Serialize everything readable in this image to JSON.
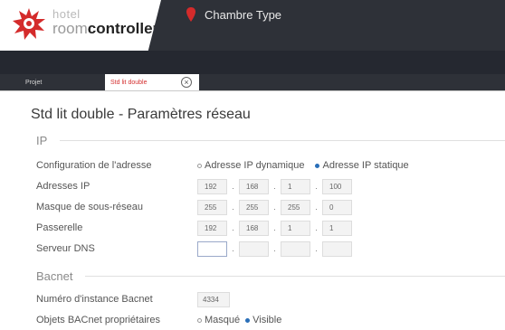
{
  "app": {
    "logo_hotel": "hotel",
    "logo_room": "room",
    "logo_controller": "controller",
    "context_title": "Chambre Type",
    "brand_color": "#d42b2b"
  },
  "tabs": [
    {
      "label": "Projet",
      "active": false
    },
    {
      "label": "Std lit double",
      "active": true
    }
  ],
  "page": {
    "title": "Std lit double - Paramètres réseau"
  },
  "ip_section": {
    "title": "IP",
    "config_label": "Configuration de l'adresse",
    "config_options": [
      {
        "label": "Adresse IP dynamique",
        "selected": false
      },
      {
        "label": "Adresse IP statique",
        "selected": true
      }
    ],
    "fields": [
      {
        "label": "Adresses IP",
        "octets": [
          "192",
          "168",
          "1",
          "100"
        ]
      },
      {
        "label": "Masque de sous-réseau",
        "octets": [
          "255",
          "255",
          "255",
          "0"
        ]
      },
      {
        "label": "Passerelle",
        "octets": [
          "192",
          "168",
          "1",
          "1"
        ]
      },
      {
        "label": "Serveur DNS",
        "octets": [
          "",
          "",
          "",
          ""
        ]
      }
    ]
  },
  "bacnet_section": {
    "title": "Bacnet",
    "instance_label": "Numéro d'instance Bacnet",
    "instance_value": "4334",
    "objects_label": "Objets BACnet propriétaires",
    "objects_options": [
      {
        "label": "Masqué",
        "selected": false
      },
      {
        "label": "Visible",
        "selected": true
      }
    ]
  }
}
